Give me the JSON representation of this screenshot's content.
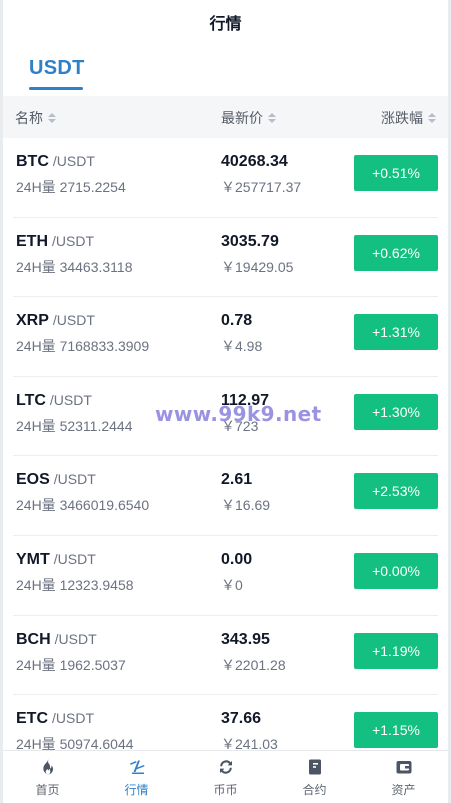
{
  "header": {
    "title": "行情"
  },
  "tabs": [
    {
      "label": "USDT",
      "active": true
    }
  ],
  "columns": {
    "name": "名称",
    "price": "最新价",
    "change": "涨跌幅"
  },
  "rows": [
    {
      "symbol": "BTC",
      "quote": "/USDT",
      "volume": "24H量 2715.2254",
      "price": "40268.34",
      "cny": "￥257717.37",
      "change": "+0.51%"
    },
    {
      "symbol": "ETH",
      "quote": "/USDT",
      "volume": "24H量 34463.3118",
      "price": "3035.79",
      "cny": "￥19429.05",
      "change": "+0.62%"
    },
    {
      "symbol": "XRP",
      "quote": "/USDT",
      "volume": "24H量 7168833.3909",
      "price": "0.78",
      "cny": "￥4.98",
      "change": "+1.31%"
    },
    {
      "symbol": "LTC",
      "quote": "/USDT",
      "volume": "24H量 52311.2444",
      "price": "112.97",
      "cny": "￥723",
      "change": "+1.30%"
    },
    {
      "symbol": "EOS",
      "quote": "/USDT",
      "volume": "24H量 3466019.6540",
      "price": "2.61",
      "cny": "￥16.69",
      "change": "+2.53%"
    },
    {
      "symbol": "YMT",
      "quote": "/USDT",
      "volume": "24H量 12323.9458",
      "price": "0.00",
      "cny": "￥0",
      "change": "+0.00%"
    },
    {
      "symbol": "BCH",
      "quote": "/USDT",
      "volume": "24H量 1962.5037",
      "price": "343.95",
      "cny": "￥2201.28",
      "change": "+1.19%"
    },
    {
      "symbol": "ETC",
      "quote": "/USDT",
      "volume": "24H量 50974.6044",
      "price": "37.66",
      "cny": "￥241.03",
      "change": "+1.15%"
    }
  ],
  "watermark": "www.99k9.net",
  "tabbar": [
    {
      "label": "首页",
      "icon": "flame-icon"
    },
    {
      "label": "行情",
      "icon": "market-icon",
      "active": true
    },
    {
      "label": "币币",
      "icon": "exchange-icon"
    },
    {
      "label": "合约",
      "icon": "contract-icon"
    },
    {
      "label": "资产",
      "icon": "wallet-icon"
    }
  ],
  "colors": {
    "accent": "#2f80c8",
    "up": "#13c082"
  }
}
